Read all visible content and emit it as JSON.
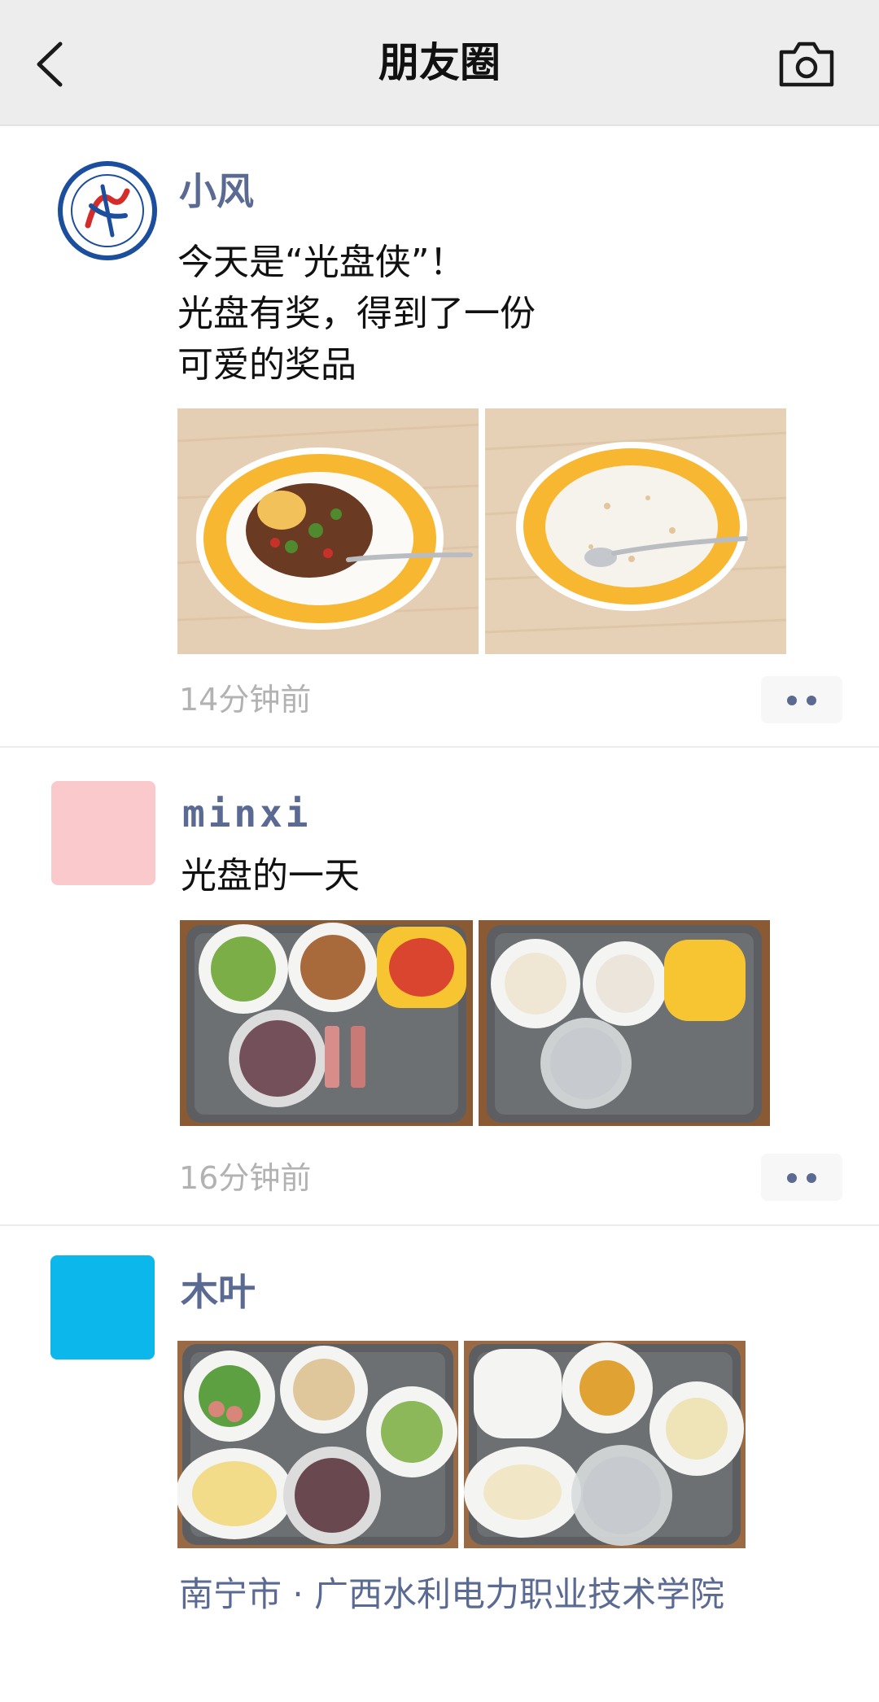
{
  "header": {
    "title": "朋友圈"
  },
  "posts": [
    {
      "name": "小风",
      "text_lines": [
        "今天是“光盘侠”！",
        "光盘有奖，得到了一份",
        "可爱的奖品"
      ],
      "time": "14分钟前",
      "avatar_color": "#1b4e9c",
      "photos": [
        "plate-with-food",
        "empty-plate"
      ]
    },
    {
      "name": "minxi",
      "text_lines": [
        "光盘的一天"
      ],
      "time": "16分钟前",
      "avatar_color": "#f9c9cb",
      "photos": [
        "tray-with-food",
        "empty-tray"
      ]
    },
    {
      "name": "木叶",
      "location": "南宁市 · 广西水利电力职业技术学院",
      "avatar_color": "#0cb7ec",
      "photos": [
        "tray-with-food",
        "empty-tray"
      ]
    }
  ],
  "colors": {
    "link": "#5a6a92",
    "header_bg": "#ededed",
    "time": "#b2b2b2"
  },
  "icons": [
    "chevron-left-icon",
    "camera-icon",
    "more-dots-icon"
  ]
}
